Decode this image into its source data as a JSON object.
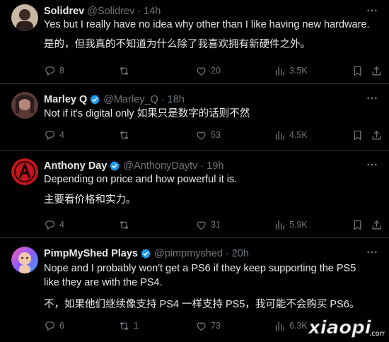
{
  "tweets": [
    {
      "name": "Solidrev",
      "verified": false,
      "handle": "@Solidrev",
      "time": "14h",
      "lines": [
        "Yes but I really have no idea why other than I like having new hardware.",
        "是的，但我真的不知道为什么除了我喜欢拥有新硬件之外。"
      ],
      "replies": "8",
      "reposts": "",
      "likes": "20",
      "views": "3.5K"
    },
    {
      "name": "Marley Q",
      "verified": true,
      "handle": "@Marley_Q",
      "time": "18h",
      "lines": [
        "Not if it's digital only 如果只是数字的话则不然"
      ],
      "replies": "4",
      "reposts": "",
      "likes": "53",
      "views": "4.5K"
    },
    {
      "name": "Anthony Day",
      "verified": true,
      "handle": "@AnthonyDaytv",
      "time": "19h",
      "lines": [
        "Depending on price and how powerful it is.",
        "主要看价格和实力。"
      ],
      "replies": "4",
      "reposts": "",
      "likes": "31",
      "views": "5.9K"
    },
    {
      "name": "PimpMyShed Plays",
      "verified": true,
      "handle": "@pimpmyshed",
      "time": "20h",
      "lines": [
        "Nope and I probably won't get a PS6 if they keep supporting the PS5 like they are with the PS4.",
        "不，如果他们继续像支持 PS4 一样支持 PS5，我可能不会购买 PS6。"
      ],
      "replies": "6",
      "reposts": "1",
      "likes": "73",
      "views": "6.3K"
    }
  ],
  "watermark": {
    "top": "小皮",
    "main": "xiaopi",
    "suffix": ".com"
  },
  "colors": {
    "background": "#000000",
    "text": "#e7e9ea",
    "muted": "#71767b",
    "verified": "#1d9bf0",
    "border": "#2f3336"
  }
}
